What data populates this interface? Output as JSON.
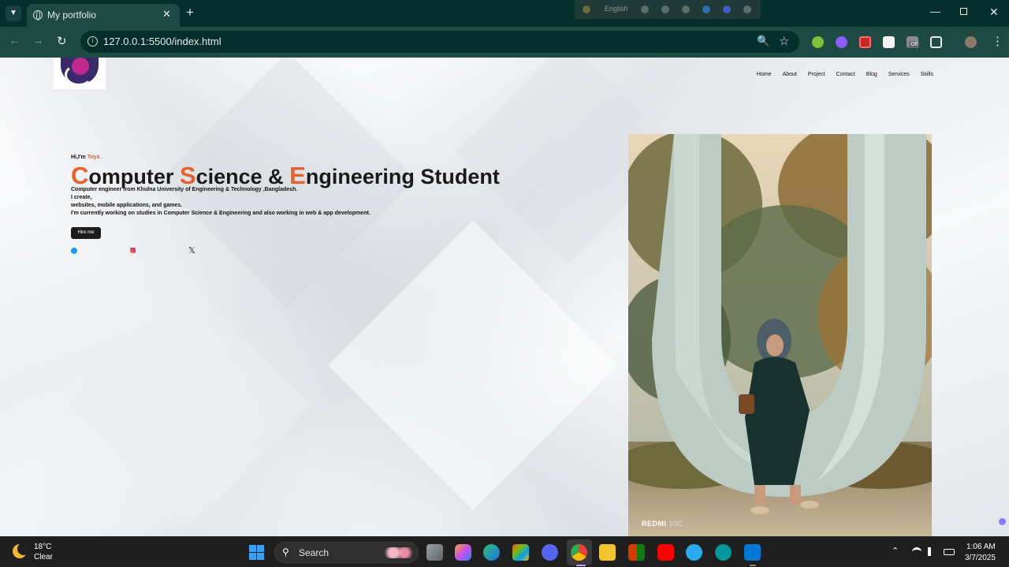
{
  "browser": {
    "tab_title": "My portfolio",
    "url": "127.0.0.1:5500/index.html",
    "ime_language": "English",
    "extension_badge": "Off"
  },
  "site": {
    "nav": [
      "Home",
      "About",
      "Project",
      "Contact",
      "Blog",
      "Services",
      "Skills"
    ],
    "greeting_prefix": "Hi,I'm",
    "greeting_name": "Toya .",
    "headline": {
      "w1_cap": "C",
      "w1_rest": "omputer ",
      "w2_cap": "S",
      "w2_rest": "cience & ",
      "w3_cap": "E",
      "w3_rest": "ngineering Student"
    },
    "bio": [
      "Computer engineer from Khulna University of Engineering & Technology ,Bangladesh.",
      "I create,",
      "websites, mobile applications, and games.",
      "I'm currently working on studies in Computer Science & Engineering and also working in web & app development."
    ],
    "hire_button": "Hire me",
    "photo_watermark_brand": "REDMI",
    "photo_watermark_model": "10C",
    "accent_color": "#e8612c"
  },
  "taskbar": {
    "weather_temp": "18°C",
    "weather_condition": "Clear",
    "search_label": "Search",
    "apps": [
      "task-view",
      "copilot",
      "edge",
      "microsoft-store",
      "discord",
      "chrome",
      "file-explorer",
      "microsoft-365",
      "youtube",
      "telegram",
      "arduino",
      "vscode"
    ],
    "time": "1:06 AM",
    "date": "3/7/2025"
  }
}
